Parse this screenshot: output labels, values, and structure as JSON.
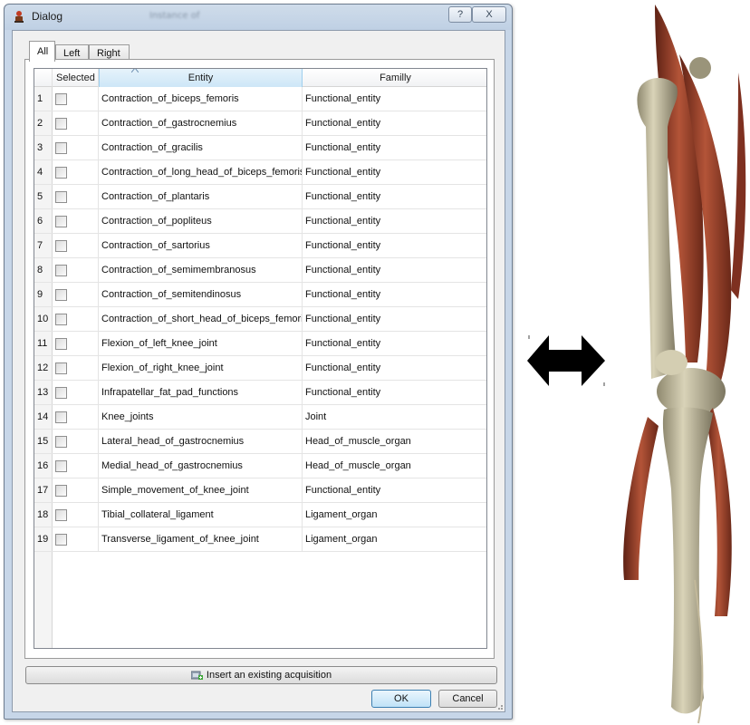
{
  "window": {
    "title": "Dialog",
    "blurred_title": "Instance of",
    "help_label": "?",
    "close_label": "X"
  },
  "tabs": [
    {
      "label": "All",
      "active": true
    },
    {
      "label": "Left",
      "active": false
    },
    {
      "label": "Right",
      "active": false
    }
  ],
  "table": {
    "headers": {
      "selected": "Selected",
      "entity": "Entity",
      "family": "Familly"
    },
    "rows": [
      {
        "num": "1",
        "entity": "Contraction_of_biceps_femoris",
        "family": "Functional_entity"
      },
      {
        "num": "2",
        "entity": "Contraction_of_gastrocnemius",
        "family": "Functional_entity"
      },
      {
        "num": "3",
        "entity": "Contraction_of_gracilis",
        "family": "Functional_entity"
      },
      {
        "num": "4",
        "entity": "Contraction_of_long_head_of_biceps_femoris",
        "family": "Functional_entity"
      },
      {
        "num": "5",
        "entity": "Contraction_of_plantaris",
        "family": "Functional_entity"
      },
      {
        "num": "6",
        "entity": "Contraction_of_popliteus",
        "family": "Functional_entity"
      },
      {
        "num": "7",
        "entity": "Contraction_of_sartorius",
        "family": "Functional_entity"
      },
      {
        "num": "8",
        "entity": "Contraction_of_semimembranosus",
        "family": "Functional_entity"
      },
      {
        "num": "9",
        "entity": "Contraction_of_semitendinosus",
        "family": "Functional_entity"
      },
      {
        "num": "10",
        "entity": "Contraction_of_short_head_of_biceps_femoris",
        "family": "Functional_entity"
      },
      {
        "num": "11",
        "entity": "Flexion_of_left_knee_joint",
        "family": "Functional_entity"
      },
      {
        "num": "12",
        "entity": "Flexion_of_right_knee_joint",
        "family": "Functional_entity"
      },
      {
        "num": "13",
        "entity": "Infrapatellar_fat_pad_functions",
        "family": "Functional_entity"
      },
      {
        "num": "14",
        "entity": "Knee_joints",
        "family": "Joint"
      },
      {
        "num": "15",
        "entity": "Lateral_head_of_gastrocnemius",
        "family": "Head_of_muscle_organ"
      },
      {
        "num": "16",
        "entity": "Medial_head_of_gastrocnemius",
        "family": "Head_of_muscle_organ"
      },
      {
        "num": "17",
        "entity": "Simple_movement_of_knee_joint",
        "family": "Functional_entity"
      },
      {
        "num": "18",
        "entity": "Tibial_collateral_ligament",
        "family": "Ligament_organ"
      },
      {
        "num": "19",
        "entity": "Transverse_ligament_of_knee_joint",
        "family": "Ligament_organ"
      }
    ]
  },
  "buttons": {
    "insert_label": "Insert an existing acquisition",
    "ok_label": "OK",
    "cancel_label": "Cancel"
  },
  "icons": {
    "app": "app-figure-icon",
    "insert": "insert-acquisition-icon",
    "arrow": "double-arrow-icon",
    "sort": "sort-ascending-icon"
  },
  "colors": {
    "title_bar": "#bfd0e4",
    "selected_header": "#cde6f7",
    "muscle": "#a8452f",
    "bone": "#cfc8ad"
  }
}
